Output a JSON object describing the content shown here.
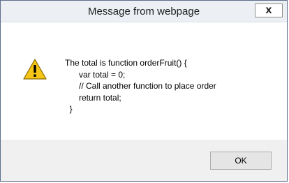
{
  "dialog": {
    "title": "Message from webpage",
    "close_label": "x",
    "icon": "warning-icon",
    "message": "The total is function orderFruit() {\n      var total = 0;\n      // Call another function to place order\n      return total;\n  }",
    "ok_label": "OK"
  },
  "colors": {
    "titlebar": "#ecf0f4",
    "border": "#5a6e8a",
    "footer": "#f0f0f0",
    "warning_fill": "#f5c518"
  }
}
